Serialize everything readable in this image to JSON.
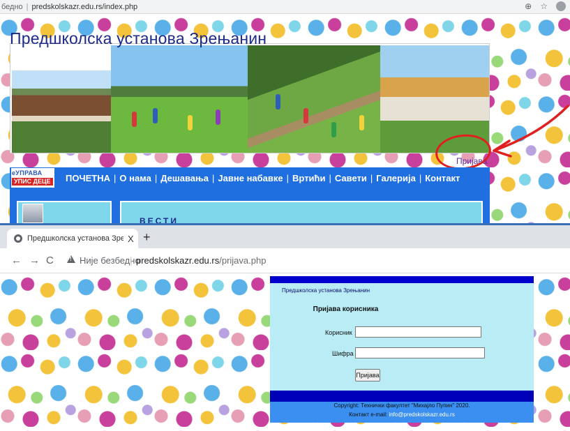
{
  "top": {
    "address_prefix": "бедно",
    "address_url": "predskolskazr.edu.rs/index.php",
    "site_title": "Предшколска установа Зрењанин",
    "login_link": "Пријава",
    "eupava_line1": "еУПРАВА",
    "eupava_line2": "УПИС ДЕЦЕ",
    "nav": [
      "ПОЧЕТНА",
      "О нама",
      "Дешавања",
      "Јавне набавке",
      "Вртићи",
      "Савети",
      "Галерија",
      "Контакт"
    ],
    "news_title": "ВЕСТИ",
    "colors": {
      "nav_bg": "#1f6fe0",
      "title": "#1c2a8a",
      "annotation": "#e02020",
      "panel": "#7fd7ec"
    }
  },
  "bottom": {
    "tab_title": "Предшколска установа Зрењанин",
    "tab_close": "X",
    "new_tab": "+",
    "security_label": "Није безбедно",
    "url_host": "predskolskazr.edu.rs",
    "url_path": "/prijava.php",
    "login": {
      "site_name": "Предшколска установа Зрењанин",
      "heading": "Пријава корисника",
      "user_label": "Корисник",
      "pass_label": "Шифра",
      "user_value": "",
      "pass_value": "",
      "submit": "Пријава"
    },
    "footer": {
      "copyright": "Copyright: Технички факултет \"Михајло Пупин\" 2020.",
      "contact_prefix": "Контакт e-mail: ",
      "email": "info@predskolskazr.edu.rs"
    },
    "colors": {
      "login_panel": "#b9ecf5",
      "frame": "#0000cc",
      "footer": "#3b8ff0"
    }
  }
}
